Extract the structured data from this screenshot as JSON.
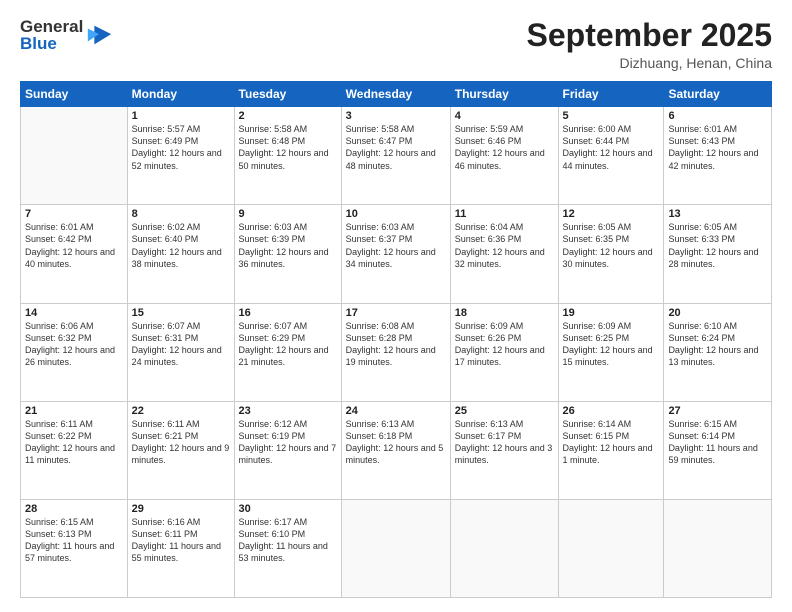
{
  "logo": {
    "general": "General",
    "blue": "Blue"
  },
  "header": {
    "month": "September 2025",
    "location": "Dizhuang, Henan, China"
  },
  "days_of_week": [
    "Sunday",
    "Monday",
    "Tuesday",
    "Wednesday",
    "Thursday",
    "Friday",
    "Saturday"
  ],
  "weeks": [
    [
      {
        "day": "",
        "info": ""
      },
      {
        "day": "1",
        "info": "Sunrise: 5:57 AM\nSunset: 6:49 PM\nDaylight: 12 hours\nand 52 minutes."
      },
      {
        "day": "2",
        "info": "Sunrise: 5:58 AM\nSunset: 6:48 PM\nDaylight: 12 hours\nand 50 minutes."
      },
      {
        "day": "3",
        "info": "Sunrise: 5:58 AM\nSunset: 6:47 PM\nDaylight: 12 hours\nand 48 minutes."
      },
      {
        "day": "4",
        "info": "Sunrise: 5:59 AM\nSunset: 6:46 PM\nDaylight: 12 hours\nand 46 minutes."
      },
      {
        "day": "5",
        "info": "Sunrise: 6:00 AM\nSunset: 6:44 PM\nDaylight: 12 hours\nand 44 minutes."
      },
      {
        "day": "6",
        "info": "Sunrise: 6:01 AM\nSunset: 6:43 PM\nDaylight: 12 hours\nand 42 minutes."
      }
    ],
    [
      {
        "day": "7",
        "info": "Sunrise: 6:01 AM\nSunset: 6:42 PM\nDaylight: 12 hours\nand 40 minutes."
      },
      {
        "day": "8",
        "info": "Sunrise: 6:02 AM\nSunset: 6:40 PM\nDaylight: 12 hours\nand 38 minutes."
      },
      {
        "day": "9",
        "info": "Sunrise: 6:03 AM\nSunset: 6:39 PM\nDaylight: 12 hours\nand 36 minutes."
      },
      {
        "day": "10",
        "info": "Sunrise: 6:03 AM\nSunset: 6:37 PM\nDaylight: 12 hours\nand 34 minutes."
      },
      {
        "day": "11",
        "info": "Sunrise: 6:04 AM\nSunset: 6:36 PM\nDaylight: 12 hours\nand 32 minutes."
      },
      {
        "day": "12",
        "info": "Sunrise: 6:05 AM\nSunset: 6:35 PM\nDaylight: 12 hours\nand 30 minutes."
      },
      {
        "day": "13",
        "info": "Sunrise: 6:05 AM\nSunset: 6:33 PM\nDaylight: 12 hours\nand 28 minutes."
      }
    ],
    [
      {
        "day": "14",
        "info": "Sunrise: 6:06 AM\nSunset: 6:32 PM\nDaylight: 12 hours\nand 26 minutes."
      },
      {
        "day": "15",
        "info": "Sunrise: 6:07 AM\nSunset: 6:31 PM\nDaylight: 12 hours\nand 24 minutes."
      },
      {
        "day": "16",
        "info": "Sunrise: 6:07 AM\nSunset: 6:29 PM\nDaylight: 12 hours\nand 21 minutes."
      },
      {
        "day": "17",
        "info": "Sunrise: 6:08 AM\nSunset: 6:28 PM\nDaylight: 12 hours\nand 19 minutes."
      },
      {
        "day": "18",
        "info": "Sunrise: 6:09 AM\nSunset: 6:26 PM\nDaylight: 12 hours\nand 17 minutes."
      },
      {
        "day": "19",
        "info": "Sunrise: 6:09 AM\nSunset: 6:25 PM\nDaylight: 12 hours\nand 15 minutes."
      },
      {
        "day": "20",
        "info": "Sunrise: 6:10 AM\nSunset: 6:24 PM\nDaylight: 12 hours\nand 13 minutes."
      }
    ],
    [
      {
        "day": "21",
        "info": "Sunrise: 6:11 AM\nSunset: 6:22 PM\nDaylight: 12 hours\nand 11 minutes."
      },
      {
        "day": "22",
        "info": "Sunrise: 6:11 AM\nSunset: 6:21 PM\nDaylight: 12 hours\nand 9 minutes."
      },
      {
        "day": "23",
        "info": "Sunrise: 6:12 AM\nSunset: 6:19 PM\nDaylight: 12 hours\nand 7 minutes."
      },
      {
        "day": "24",
        "info": "Sunrise: 6:13 AM\nSunset: 6:18 PM\nDaylight: 12 hours\nand 5 minutes."
      },
      {
        "day": "25",
        "info": "Sunrise: 6:13 AM\nSunset: 6:17 PM\nDaylight: 12 hours\nand 3 minutes."
      },
      {
        "day": "26",
        "info": "Sunrise: 6:14 AM\nSunset: 6:15 PM\nDaylight: 12 hours\nand 1 minute."
      },
      {
        "day": "27",
        "info": "Sunrise: 6:15 AM\nSunset: 6:14 PM\nDaylight: 11 hours\nand 59 minutes."
      }
    ],
    [
      {
        "day": "28",
        "info": "Sunrise: 6:15 AM\nSunset: 6:13 PM\nDaylight: 11 hours\nand 57 minutes."
      },
      {
        "day": "29",
        "info": "Sunrise: 6:16 AM\nSunset: 6:11 PM\nDaylight: 11 hours\nand 55 minutes."
      },
      {
        "day": "30",
        "info": "Sunrise: 6:17 AM\nSunset: 6:10 PM\nDaylight: 11 hours\nand 53 minutes."
      },
      {
        "day": "",
        "info": ""
      },
      {
        "day": "",
        "info": ""
      },
      {
        "day": "",
        "info": ""
      },
      {
        "day": "",
        "info": ""
      }
    ]
  ]
}
